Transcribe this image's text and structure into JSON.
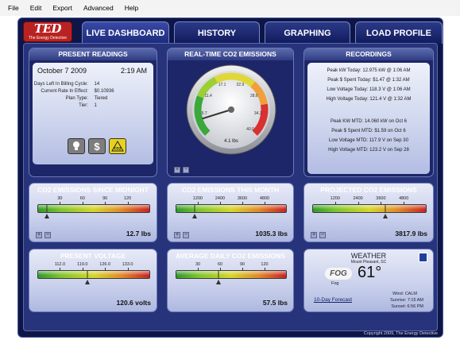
{
  "menu": [
    "File",
    "Edit",
    "Export",
    "Advanced",
    "Help"
  ],
  "logo": {
    "title": "TED",
    "subtitle": "The Energy Detective"
  },
  "tabs": [
    {
      "label": "LIVE DASHBOARD",
      "active": true
    },
    {
      "label": "HISTORY",
      "active": false
    },
    {
      "label": "GRAPHING",
      "active": false
    },
    {
      "label": "LOAD PROFILE",
      "active": false
    }
  ],
  "present_readings": {
    "title": "PRESENT READINGS",
    "date": "October 7 2009",
    "time": "2:19 AM",
    "rows": [
      {
        "label": "Days Left In Billing Cycle:",
        "value": "14"
      },
      {
        "label": "Current Rate In Effect:",
        "value": "$0.10936"
      },
      {
        "label": "Plan Type:",
        "value": "Tiered"
      },
      {
        "label": "Tier:",
        "value": "1"
      }
    ],
    "icons": [
      "lightbulb-icon",
      "dollar-icon",
      "co2-warning-icon"
    ],
    "dollar_glyph": "$",
    "co2_glyph": "CO2"
  },
  "gauge": {
    "title": "REAL-TIME CO2 EMISSIONS",
    "tick_labels": [
      "5.7",
      "11.4",
      "17.1",
      "22.9",
      "28.6",
      "34.3",
      "40.0"
    ],
    "value": 4.1,
    "value_text": "4.1 lbs",
    "min": 0,
    "max": 40
  },
  "recordings": {
    "title": "RECORDINGS",
    "lines_today": [
      "Peak kW Today: 12.975 kW @ 1:06 AM",
      "Peak $ Spent Today: $1.47 @ 1:32 AM",
      "Low Voltage Today: 118.3 V @ 1:06 AM",
      "High Voltage Today: 121.4 V @ 1:32 AM"
    ],
    "lines_mtd": [
      "Peak KW MTD: 14.060 kW on Oct 6",
      "Peak $ Spent MTD: $1.59 on Oct 6",
      "Low Voltage MTD: 117.9 V on Sep 30",
      "High Voltage MTD: 123.2 V on Sep 28"
    ]
  },
  "bars": [
    {
      "title": "CO2 EMISSIONS SINCE MIDNIGHT",
      "ticks": [
        "30",
        "60",
        "90",
        "120"
      ],
      "value": 12.7,
      "max": 150,
      "value_text": "12.7 lbs"
    },
    {
      "title": "CO2 EMISSIONS THIS MONTH",
      "ticks": [
        "1200",
        "2400",
        "3600",
        "4800"
      ],
      "value": 1035.3,
      "max": 6000,
      "value_text": "1035.3 lbs"
    },
    {
      "title": "PROJECTED CO2 EMISSIONS",
      "ticks": [
        "1200",
        "2400",
        "3600",
        "4800"
      ],
      "value": 3817.9,
      "max": 6000,
      "value_text": "3817.9 lbs"
    },
    {
      "title": "PRESENT VOLTAGE",
      "ticks": [
        "112.0",
        "119.0",
        "126.0",
        "133.0"
      ],
      "value": 120.6,
      "max": 140,
      "min": 105,
      "value_text": "120.6 volts"
    },
    {
      "title": "AVERAGE DAILY CO2 EMISSIONS",
      "ticks": [
        "30",
        "60",
        "90",
        "120"
      ],
      "value": 57.5,
      "max": 150,
      "value_text": "57.5 lbs"
    }
  ],
  "weather": {
    "title": "WEATHER",
    "location": "Mount Pleasant, SC",
    "badge": "FOG",
    "condition": "Fog",
    "temperature": "61°",
    "forecast_link": "10-Day Forecast",
    "wind": "Wind: CALM",
    "sunrise": "Sunrise: 7:15 AM",
    "sunset": "Sunset: 6:56 PM"
  },
  "copyright": "Copyright 2009, The Energy Detective",
  "colors": {
    "frame": "#0d1646",
    "panel": "#27347b",
    "logo": "#b82322"
  }
}
